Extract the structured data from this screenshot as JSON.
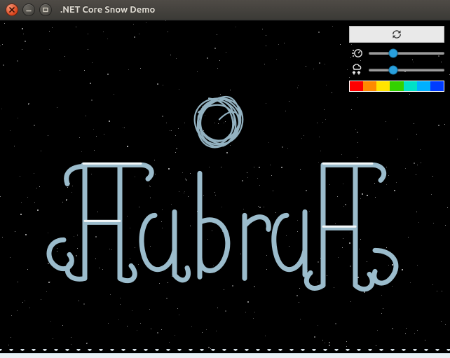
{
  "window": {
    "title": ".NET Core Snow Demo",
    "close_name": "close-icon",
    "minimize_name": "minimize-icon",
    "maximize_name": "maximize-icon"
  },
  "controls": {
    "reset_name": "refresh-icon",
    "slider1": {
      "icon_name": "speed-icon",
      "percent": 32
    },
    "slider2": {
      "icon_name": "snowfall-icon",
      "percent": 32
    },
    "hue_colors": [
      "#ff0000",
      "#ff8a00",
      "#ffe400",
      "#33d100",
      "#00e1c6",
      "#00b0ff",
      "#003cff"
    ]
  },
  "scene": {
    "logo_text": "HabraHabr",
    "logo_color": "#9bbccc",
    "snow_seed": 987654321,
    "snow_count": 420
  }
}
